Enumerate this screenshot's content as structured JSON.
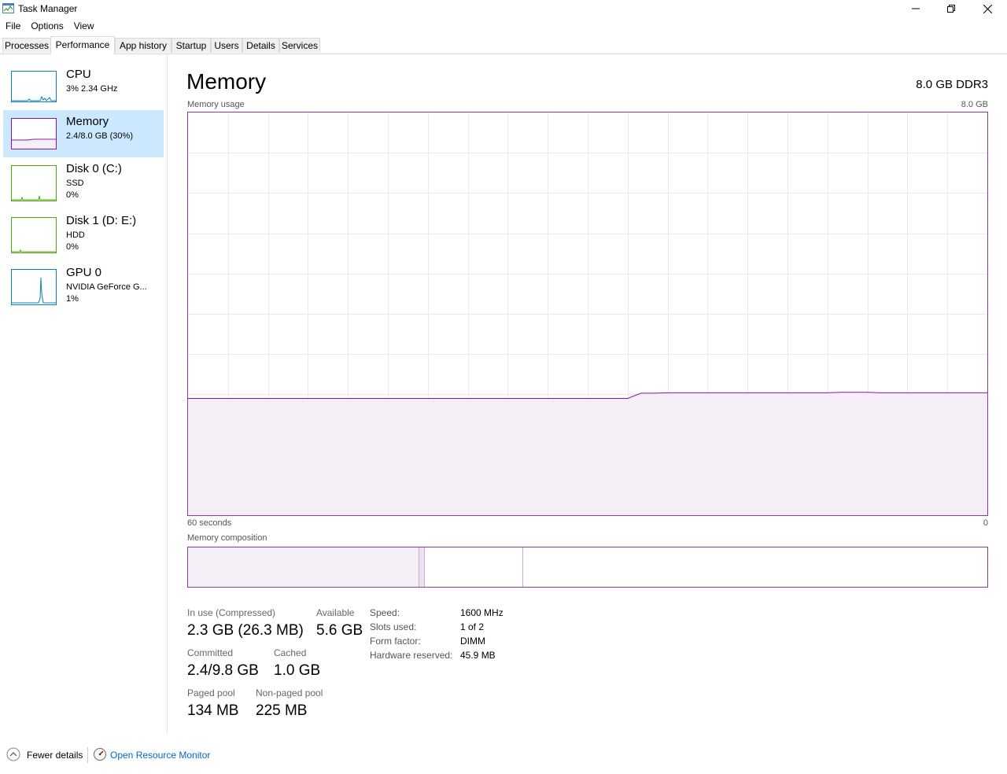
{
  "window": {
    "title": "Task Manager"
  },
  "menu": [
    "File",
    "Options",
    "View"
  ],
  "tabs": [
    {
      "label": "Processes",
      "active": false
    },
    {
      "label": "Performance",
      "active": true
    },
    {
      "label": "App history",
      "active": false
    },
    {
      "label": "Startup",
      "active": false
    },
    {
      "label": "Users",
      "active": false
    },
    {
      "label": "Details",
      "active": false
    },
    {
      "label": "Services",
      "active": false
    }
  ],
  "sidebar": {
    "items": [
      {
        "title": "CPU",
        "line1": "3%  2.34 GHz",
        "line2": "",
        "color": "#117dbb",
        "selected": false
      },
      {
        "title": "Memory",
        "line1": "2.4/8.0 GB (30%)",
        "line2": "",
        "color": "#8b12ae",
        "selected": true
      },
      {
        "title": "Disk 0 (C:)",
        "line1": "SSD",
        "line2": "0%",
        "color": "#4da60c",
        "selected": false
      },
      {
        "title": "Disk 1 (D: E:)",
        "line1": "HDD",
        "line2": "0%",
        "color": "#4da60c",
        "selected": false
      },
      {
        "title": "GPU 0",
        "line1": "NVIDIA GeForce G...",
        "line2": "1%",
        "color": "#117dbb",
        "selected": false
      }
    ]
  },
  "memory": {
    "title": "Memory",
    "spec": "8.0 GB DDR3",
    "usage_label": "Memory usage",
    "usage_max": "8.0 GB",
    "time_left": "60 seconds",
    "time_right": "0",
    "composition_label": "Memory composition",
    "accent_color": "#8b12ae",
    "stats": {
      "in_use_label": "In use (Compressed)",
      "in_use_value": "2.3 GB (26.3 MB)",
      "available_label": "Available",
      "available_value": "5.6 GB",
      "committed_label": "Committed",
      "committed_value": "2.4/9.8 GB",
      "cached_label": "Cached",
      "cached_value": "1.0 GB",
      "paged_label": "Paged pool",
      "paged_value": "134 MB",
      "nonpaged_label": "Non-paged pool",
      "nonpaged_value": "225 MB"
    },
    "details": [
      {
        "label": "Speed:",
        "value": "1600 MHz"
      },
      {
        "label": "Slots used:",
        "value": "1 of 2"
      },
      {
        "label": "Form factor:",
        "value": "DIMM"
      },
      {
        "label": "Hardware reserved:",
        "value": "45.9 MB"
      }
    ],
    "usage_fraction": 0.29
  },
  "footer": {
    "fewer_details": "Fewer details",
    "open_resource_monitor": "Open Resource Monitor"
  }
}
